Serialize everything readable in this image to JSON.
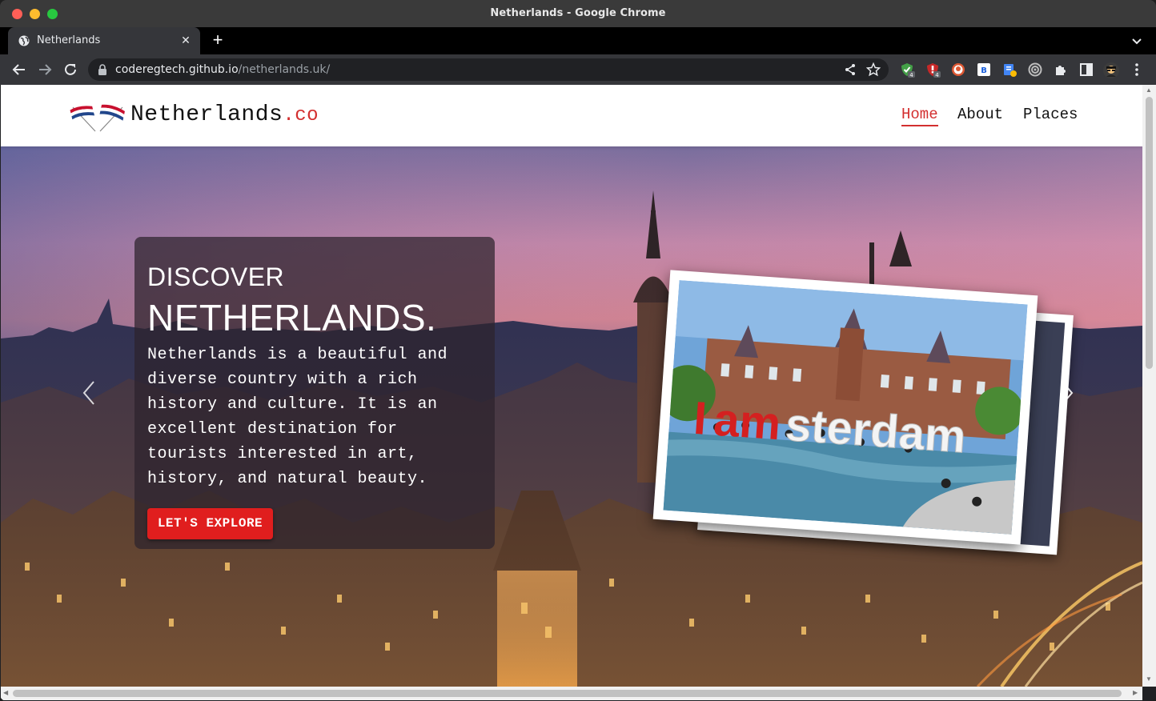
{
  "window": {
    "title": "Netherlands - Google Chrome"
  },
  "tab": {
    "title": "Netherlands",
    "close": "✕",
    "new_tab": "+"
  },
  "address": {
    "host": "coderegtech.github.io",
    "path": "/netherlands.uk/"
  },
  "extensions": [
    {
      "name": "adguard-icon",
      "badge": "4",
      "color": "#43a047"
    },
    {
      "name": "ublock-icon",
      "badge": "4",
      "color": "#c62828"
    },
    {
      "name": "duckduckgo-icon",
      "color": "#de5833"
    },
    {
      "name": "bitwarden-icon",
      "color": "#175ddc"
    },
    {
      "name": "translate-icon",
      "color": "#4285f4"
    },
    {
      "name": "circle-target-icon",
      "color": "#bdbdbd"
    },
    {
      "name": "puzzle-extensions-icon",
      "color": "#e8eaed"
    },
    {
      "name": "sidepanel-icon",
      "color": "#e8eaed"
    },
    {
      "name": "profile-avatar-icon",
      "color": "#f5c542"
    },
    {
      "name": "kebab-menu-icon",
      "color": "#e8eaed"
    }
  ],
  "site": {
    "brand": {
      "name": "Netherlands",
      "suffix": ".co"
    },
    "nav": {
      "home": "Home",
      "about": "About",
      "places": "Places"
    },
    "hero": {
      "discover": "DISCOVER",
      "title": "NETHERLANDS.",
      "text": "Netherlands is a beautiful and diverse country with a rich history and culture. It is an excellent destination for tourists interested in art, history, and natural beauty.",
      "button": "LET'S EXPLORE",
      "postcard_text": "Iamsterdam"
    }
  },
  "colors": {
    "accent": "#d32f2f",
    "button": "#e01e1e"
  }
}
